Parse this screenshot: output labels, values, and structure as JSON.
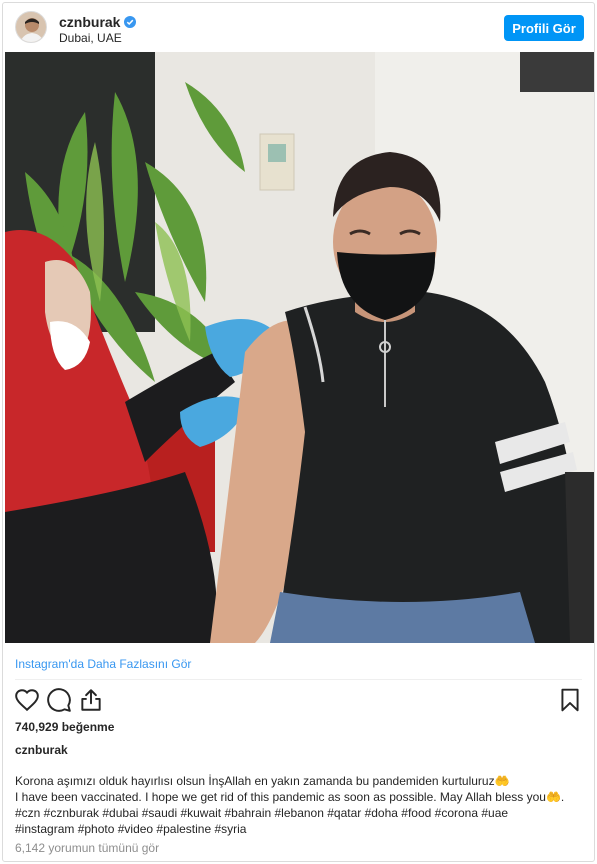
{
  "post": {
    "username": "cznburak",
    "location": "Dubai, UAE",
    "profile_button": "Profili Gör",
    "more_link": "Instagram'da Daha Fazlasını Gör",
    "likes": "740,929 beğenme",
    "caption_user": "cznburak",
    "caption_lines": [
      "Korona aşımızı olduk hayırlısı olsun İnşAllah en yakın zamanda bu pandemiden kurtuluruz🤲",
      "I have been vaccinated. I hope we get rid of this pandemic as soon as possible. May Allah bless you🤲.",
      "#czn #cznburak #dubai #saudi #kuwait #bahrain #lebanon #qatar #doha #food #corona #uae",
      "#instagram #photo #video #palestine #syria"
    ],
    "comments": "6,142 yorumun tümünü gör"
  },
  "icons": {
    "verified": "verified-badge-icon",
    "like": "heart-icon",
    "comment": "comment-icon",
    "share": "share-icon",
    "save": "bookmark-icon"
  },
  "colors": {
    "accent": "#0095f6",
    "link": "#3897f0",
    "muted": "#8e8e8e",
    "text": "#262626"
  }
}
